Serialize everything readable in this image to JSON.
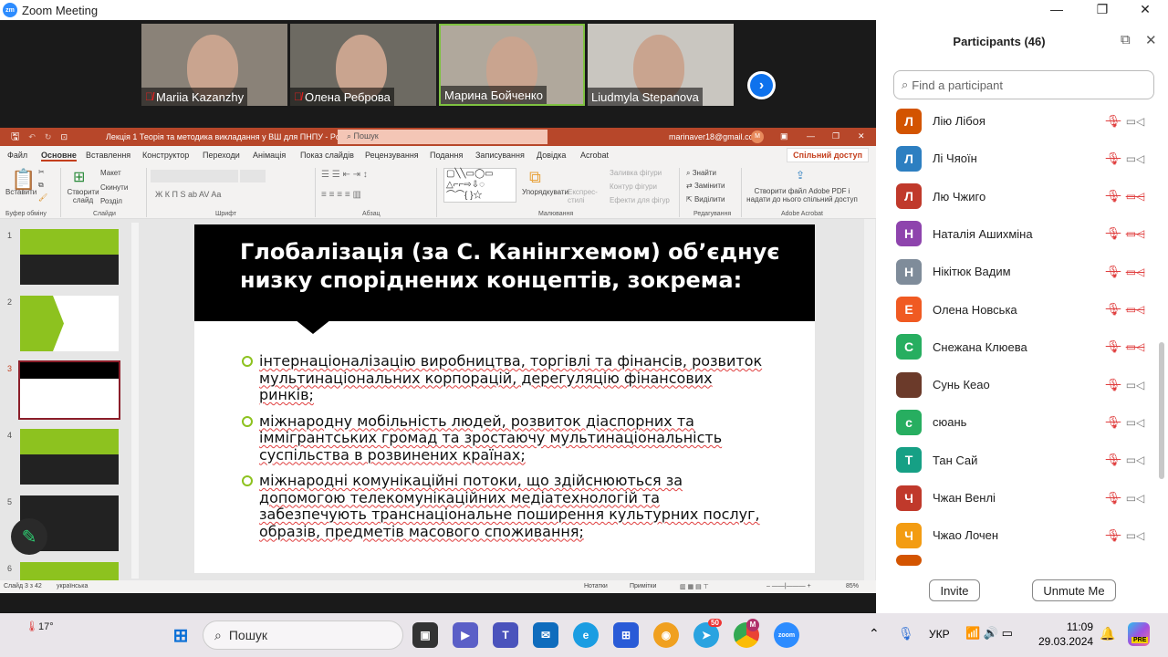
{
  "window": {
    "title": "Zoom Meeting",
    "logo": "zm"
  },
  "videos": [
    {
      "name": "Mariia Kazanzhy",
      "muted": true,
      "bg": "#8a8278",
      "speaking": false
    },
    {
      "name": "Олена Реброва",
      "muted": true,
      "bg": "#6d6a62",
      "speaking": false
    },
    {
      "name": "Марина Бойченко",
      "muted": false,
      "bg": "#b0a89c",
      "speaking": true
    },
    {
      "name": "Liudmyla Stepanova",
      "muted": false,
      "bg": "#c9c6c0",
      "speaking": false
    }
  ],
  "ppt": {
    "doc_title": "Лекція 1 Теорія та методика викладання у ВШ для ПНПУ  -  PowerPoint",
    "search": "Пошук",
    "account": "marinaver18@gmail.com",
    "avatar": "M",
    "tabs": [
      "Файл",
      "Основне",
      "Вставлення",
      "Конструктор",
      "Переходи",
      "Анімація",
      "Показ слайдів",
      "Рецензування",
      "Подання",
      "Записування",
      "Довідка",
      "Acrobat"
    ],
    "active_tab": "Основне",
    "share": "Спільний доступ",
    "ribbon": {
      "paste": "Вставити",
      "new_slide": "Створити слайд",
      "layout": "Макет",
      "reset": "Скинути",
      "section": "Розділ",
      "arrange": "Упорядкувати",
      "quick_styles": "Експрес-стилі",
      "shape_fill": "Заливка фігури",
      "shape_outline": "Контур фігури",
      "shape_effects": "Ефекти для фігур",
      "find": "Знайти",
      "replace": "Замінити",
      "select": "Виділити",
      "adobe": "Створити файл Adobe PDF і надати до нього спільний доступ",
      "groups": [
        "Буфер обміну",
        "Слайди",
        "Шрифт",
        "Абзац",
        "Малювання",
        "Редагування",
        "Adobe Acrobat"
      ],
      "font_buttons": "Ж  К  П  S  ab  AV  Aa"
    },
    "thumbs": [
      {
        "n": "1",
        "bg": "#8dc21f",
        "dark": true
      },
      {
        "n": "2",
        "bg": "#fff",
        "dark": false
      },
      {
        "n": "3",
        "bg": "#fff",
        "dark": false,
        "selected": true
      },
      {
        "n": "4",
        "bg": "#8dc21f",
        "dark": true
      },
      {
        "n": "5",
        "bg": "#222",
        "dark": true
      },
      {
        "n": "6",
        "bg": "#8dc21f",
        "dark": true
      }
    ],
    "slide": {
      "title": "Глобалізація (за С. Канінгхемом) об’єднує низку споріднених концептів, зокрема:",
      "bullets": [
        "інтернаціоналізацію виробництва, торгівлі та фінансів, розвиток мультинаціональних корпорацій, дерегуляцію фінансових ринків;",
        "міжнародну мобільність людей, розвиток діаспорних та іммігрантських громад та зростаючу мультинаціональність суспільства в розвинених країнах;",
        "міжнародні комунікаційні потоки, що здійснюються за допомогою телекомунікаційних медіатехнологій та забезпечують транснаціональне поширення культурних послуг, образів, предметів масового споживання;"
      ]
    },
    "status": {
      "slide": "Слайд 3 з 42",
      "lang": "українська",
      "notes": "Нотатки",
      "comments": "Примітки",
      "zoom": "85%"
    }
  },
  "participants": {
    "title": "Participants (46)",
    "search_placeholder": "Find a participant",
    "list": [
      {
        "name": "Лію Лібоя",
        "initial": "Л",
        "color": "#d35400",
        "cam_off": false
      },
      {
        "name": "Лі Чяоїн",
        "initial": "Л",
        "color": "#2d7fc1",
        "cam_off": false
      },
      {
        "name": "Лю Чжиго",
        "initial": "Л",
        "color": "#c0392b",
        "cam_off": true
      },
      {
        "name": "Наталія Ашихміна",
        "initial": "Н",
        "color": "#8e44ad",
        "cam_off": true
      },
      {
        "name": "Нікітюк Вадим",
        "initial": "Н",
        "color": "#7f8c9a",
        "cam_off": true
      },
      {
        "name": "Олена Новська",
        "initial": "Е",
        "color": "#f05a22",
        "cam_off": true
      },
      {
        "name": "Снежана Клюева",
        "initial": "С",
        "color": "#27ae60",
        "cam_off": true
      },
      {
        "name": "Сунь Кеао",
        "initial": "",
        "color": "#6b3a2a",
        "cam_off": false
      },
      {
        "name": "сюань",
        "initial": "с",
        "color": "#27ae60",
        "cam_off": false
      },
      {
        "name": "Тан Сай",
        "initial": "Т",
        "color": "#16a085",
        "cam_off": false
      },
      {
        "name": "Чжан Венлі",
        "initial": "Ч",
        "color": "#c0392b",
        "cam_off": false
      },
      {
        "name": "Чжао Лочен",
        "initial": "Ч",
        "color": "#f39c12",
        "cam_off": false
      }
    ],
    "invite": "Invite",
    "unmute": "Unmute Me"
  },
  "taskbar": {
    "weather": "17°",
    "search": "Пошук",
    "telegram_badge": "50",
    "chrome_badge": "M",
    "zoom": "zoom",
    "lang": "УКР",
    "time": "11:09",
    "date": "29.03.2024",
    "copilot": "PRE"
  }
}
